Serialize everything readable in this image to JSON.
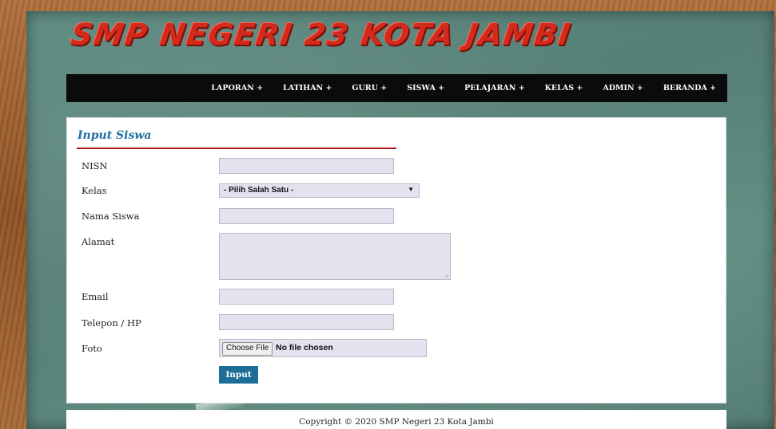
{
  "header": {
    "site_title": "SMP NEGERI 23 KOTA JAMBI"
  },
  "nav": {
    "items": [
      {
        "label": "LAPORAN +"
      },
      {
        "label": "LATIHAN +"
      },
      {
        "label": "GURU +"
      },
      {
        "label": "SISWA +"
      },
      {
        "label": "PELAJARAN +"
      },
      {
        "label": "KELAS +"
      },
      {
        "label": "ADMIN +"
      },
      {
        "label": "BERANDA +"
      }
    ]
  },
  "form": {
    "title": "Input Siswa",
    "fields": {
      "nisn": {
        "label": "NISN",
        "value": ""
      },
      "kelas": {
        "label": "Kelas",
        "selected": "- Pilih Salah Satu -"
      },
      "nama": {
        "label": "Nama Siswa",
        "value": ""
      },
      "alamat": {
        "label": "Alamat",
        "value": ""
      },
      "email": {
        "label": "Email",
        "value": ""
      },
      "telepon": {
        "label": "Telepon / HP",
        "value": ""
      },
      "foto": {
        "label": "Foto",
        "button_label": "Choose File",
        "status": "No file chosen"
      }
    },
    "submit_label": "Input"
  },
  "footer": {
    "copyright": "Copyright © 2020 SMP Negeri 23 Kota Jambi"
  },
  "colors": {
    "title_red": "#d42a1c",
    "nav_background": "#0b0b0b",
    "section_title_blue": "#1e6fa0",
    "accent_rule": "#b01515",
    "button_blue": "#1d6e96",
    "input_background": "#e3e3f0"
  }
}
